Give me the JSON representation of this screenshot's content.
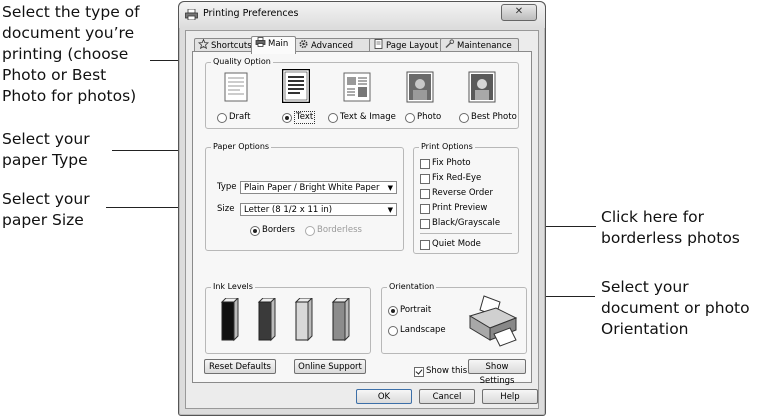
{
  "callouts": {
    "document_type": "Select the type of\ndocument you’re\nprinting (choose\nPhoto or Best\nPhoto for photos)",
    "paper_type": "Select your\npaper Type",
    "paper_size": "Select your\npaper Size",
    "borderless": "Click here for\nborderless photos",
    "orientation": "Select your\ndocument or photo\nOrientation"
  },
  "window": {
    "title": "Printing Preferences",
    "close_label": "✕"
  },
  "tabs": [
    {
      "label": "Shortcuts",
      "icon": "star-icon"
    },
    {
      "label": "Main",
      "icon": "printer-icon",
      "active": true
    },
    {
      "label": "Advanced",
      "icon": "gear-icon"
    },
    {
      "label": "Page Layout",
      "icon": "page-icon"
    },
    {
      "label": "Maintenance",
      "icon": "wrench-icon"
    }
  ],
  "quality": {
    "title": "Quality Option",
    "options": [
      {
        "label": "Draft",
        "icon": "draft-doc-icon",
        "selected": false
      },
      {
        "label": "Text",
        "icon": "text-doc-icon",
        "selected": true
      },
      {
        "label": "Text & Image",
        "icon": "text-image-doc-icon",
        "selected": false
      },
      {
        "label": "Photo",
        "icon": "photo-icon",
        "selected": false
      },
      {
        "label": "Best Photo",
        "icon": "best-photo-icon",
        "selected": false
      }
    ]
  },
  "paper": {
    "title": "Paper Options",
    "type_label": "Type",
    "type_value": "Plain Paper / Bright White Paper",
    "size_label": "Size",
    "size_value": "Letter (8 1/2 x 11 in)",
    "borders_label": "Borders",
    "borderless_label": "Borderless",
    "borders_selected": true
  },
  "print_options": {
    "title": "Print Options",
    "items": [
      {
        "label": "Fix Photo",
        "checked": false
      },
      {
        "label": "Fix Red-Eye",
        "checked": false
      },
      {
        "label": "Reverse Order",
        "checked": false
      },
      {
        "label": "Print Preview",
        "checked": false
      },
      {
        "label": "Black/Grayscale",
        "checked": false
      }
    ],
    "quiet_mode": {
      "label": "Quiet Mode",
      "checked": false
    }
  },
  "ink": {
    "title": "Ink Levels",
    "colors": [
      "#111111",
      "#3a3a3a",
      "#d8d8d8",
      "#8c8c8c"
    ]
  },
  "orientation": {
    "title": "Orientation",
    "portrait": "Portrait",
    "landscape": "Landscape",
    "portrait_selected": true
  },
  "show_screen": {
    "label": "Show this screen first",
    "checked": true
  },
  "buttons": {
    "reset": "Reset Defaults",
    "support": "Online Support",
    "show_settings": "Show Settings",
    "ok": "OK",
    "cancel": "Cancel",
    "help": "Help"
  }
}
